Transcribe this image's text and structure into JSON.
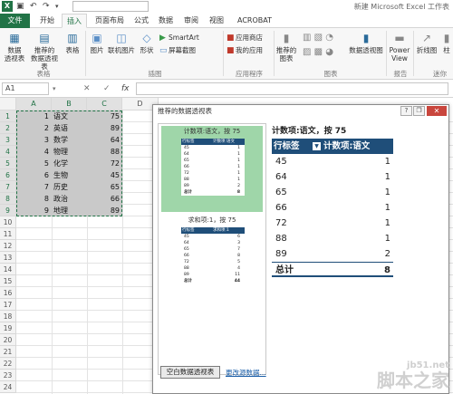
{
  "title_bar": {
    "app_title": "新建 Microsoft Excel 工作表",
    "undo_icon": "undo-icon",
    "redo_icon": "redo-icon"
  },
  "ribbon_tabs": [
    "文件",
    "开始",
    "插入",
    "页面布局",
    "公式",
    "数据",
    "审阅",
    "视图",
    "ACROBAT"
  ],
  "active_tab": "插入",
  "ribbon": {
    "pivot_table": "数据\n透视表",
    "recommended_pivot": "推荐的\n数据透视表",
    "table": "表格",
    "picture": "图片",
    "online_picture": "联机图片",
    "shapes": "形状",
    "smartart": "SmartArt",
    "screenshot": "屏幕截图",
    "app_store": "应用商店",
    "my_apps": "我的应用",
    "recommended_charts": "推荐的\n图表",
    "pivot_chart": "数据透视图",
    "power_view": "Power\nView",
    "line_chart": "折线图",
    "column_chart": "柱",
    "groups": {
      "tables": "表格",
      "illustrations": "插图",
      "apps": "应用程序",
      "charts": "图表",
      "reports": "报告",
      "sparklines": "迷你"
    }
  },
  "formula_bar": {
    "name_box": "A1",
    "cancel_icon": "✕",
    "confirm_icon": "✓",
    "fx": "fx"
  },
  "sheet": {
    "columns": [
      "A",
      "B",
      "C",
      "D"
    ],
    "rows": [
      "1",
      "2",
      "3",
      "4",
      "5",
      "6",
      "7",
      "8",
      "9",
      "10",
      "11",
      "12",
      "13",
      "14",
      "15",
      "16",
      "17",
      "18",
      "19",
      "20",
      "21",
      "22",
      "23",
      "24"
    ],
    "data": [
      {
        "a": "1",
        "b": "语文",
        "c": "75"
      },
      {
        "a": "2",
        "b": "英语",
        "c": "89"
      },
      {
        "a": "3",
        "b": "数学",
        "c": "64"
      },
      {
        "a": "4",
        "b": "物理",
        "c": "88"
      },
      {
        "a": "5",
        "b": "化学",
        "c": "72"
      },
      {
        "a": "6",
        "b": "生物",
        "c": "45"
      },
      {
        "a": "7",
        "b": "历史",
        "c": "65"
      },
      {
        "a": "8",
        "b": "政治",
        "c": "66"
      },
      {
        "a": "9",
        "b": "地理",
        "c": "89"
      }
    ]
  },
  "dialog": {
    "title": "推荐的数据透视表",
    "help": "?",
    "restore": "❐",
    "close": "✕",
    "thumbnails": [
      {
        "title": "计数项:语文，按 75",
        "col1": "行标签",
        "col2": "计数项:语文",
        "rows": [
          [
            "45",
            "1"
          ],
          [
            "64",
            "1"
          ],
          [
            "65",
            "1"
          ],
          [
            "66",
            "1"
          ],
          [
            "72",
            "1"
          ],
          [
            "88",
            "1"
          ],
          [
            "89",
            "2"
          ]
        ],
        "total": [
          "总计",
          "8"
        ]
      },
      {
        "title": "求和项:1，按 75",
        "col1": "行标签",
        "col2": "求和项:1",
        "rows": [
          [
            "45",
            "6"
          ],
          [
            "64",
            "3"
          ],
          [
            "65",
            "7"
          ],
          [
            "66",
            "8"
          ],
          [
            "72",
            "5"
          ],
          [
            "88",
            "4"
          ],
          [
            "89",
            "11"
          ]
        ],
        "total": [
          "总计",
          "44"
        ]
      }
    ],
    "preview": {
      "title": "计数项:语文，按 75",
      "col1": "行标签",
      "col2": "计数项:语文",
      "rows": [
        {
          "k": "45",
          "v": "1"
        },
        {
          "k": "64",
          "v": "1"
        },
        {
          "k": "65",
          "v": "1"
        },
        {
          "k": "66",
          "v": "1"
        },
        {
          "k": "72",
          "v": "1"
        },
        {
          "k": "88",
          "v": "1"
        },
        {
          "k": "89",
          "v": "2"
        }
      ],
      "total_label": "总计",
      "total_value": "8"
    },
    "blank_button": "空白数据透视表",
    "change_source_link": "更改源数据..."
  },
  "watermark": {
    "site": "jb51.net",
    "name": "脚本之家"
  }
}
